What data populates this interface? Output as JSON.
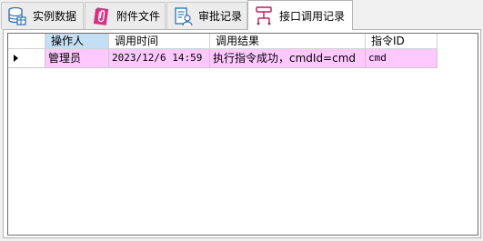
{
  "tabs": [
    {
      "label": "实例数据",
      "icon": "database-table-icon",
      "active": false
    },
    {
      "label": "附件文件",
      "icon": "attachment-icon",
      "active": false
    },
    {
      "label": "审批记录",
      "icon": "approval-record-icon",
      "active": false
    },
    {
      "label": "接口调用记录",
      "icon": "api-call-icon",
      "active": true
    }
  ],
  "grid": {
    "columns": [
      "操作人",
      "调用时间",
      "调用结果",
      "指令ID"
    ],
    "rows": [
      {
        "operator": "管理员",
        "call_time": "2023/12/6 14:59",
        "result": "执行指令成功，cmdId=cmd",
        "command_id": "cmd"
      }
    ]
  },
  "colors": {
    "row_highlight": "#ffc8ff",
    "sorted_header": "#c4dff3"
  }
}
